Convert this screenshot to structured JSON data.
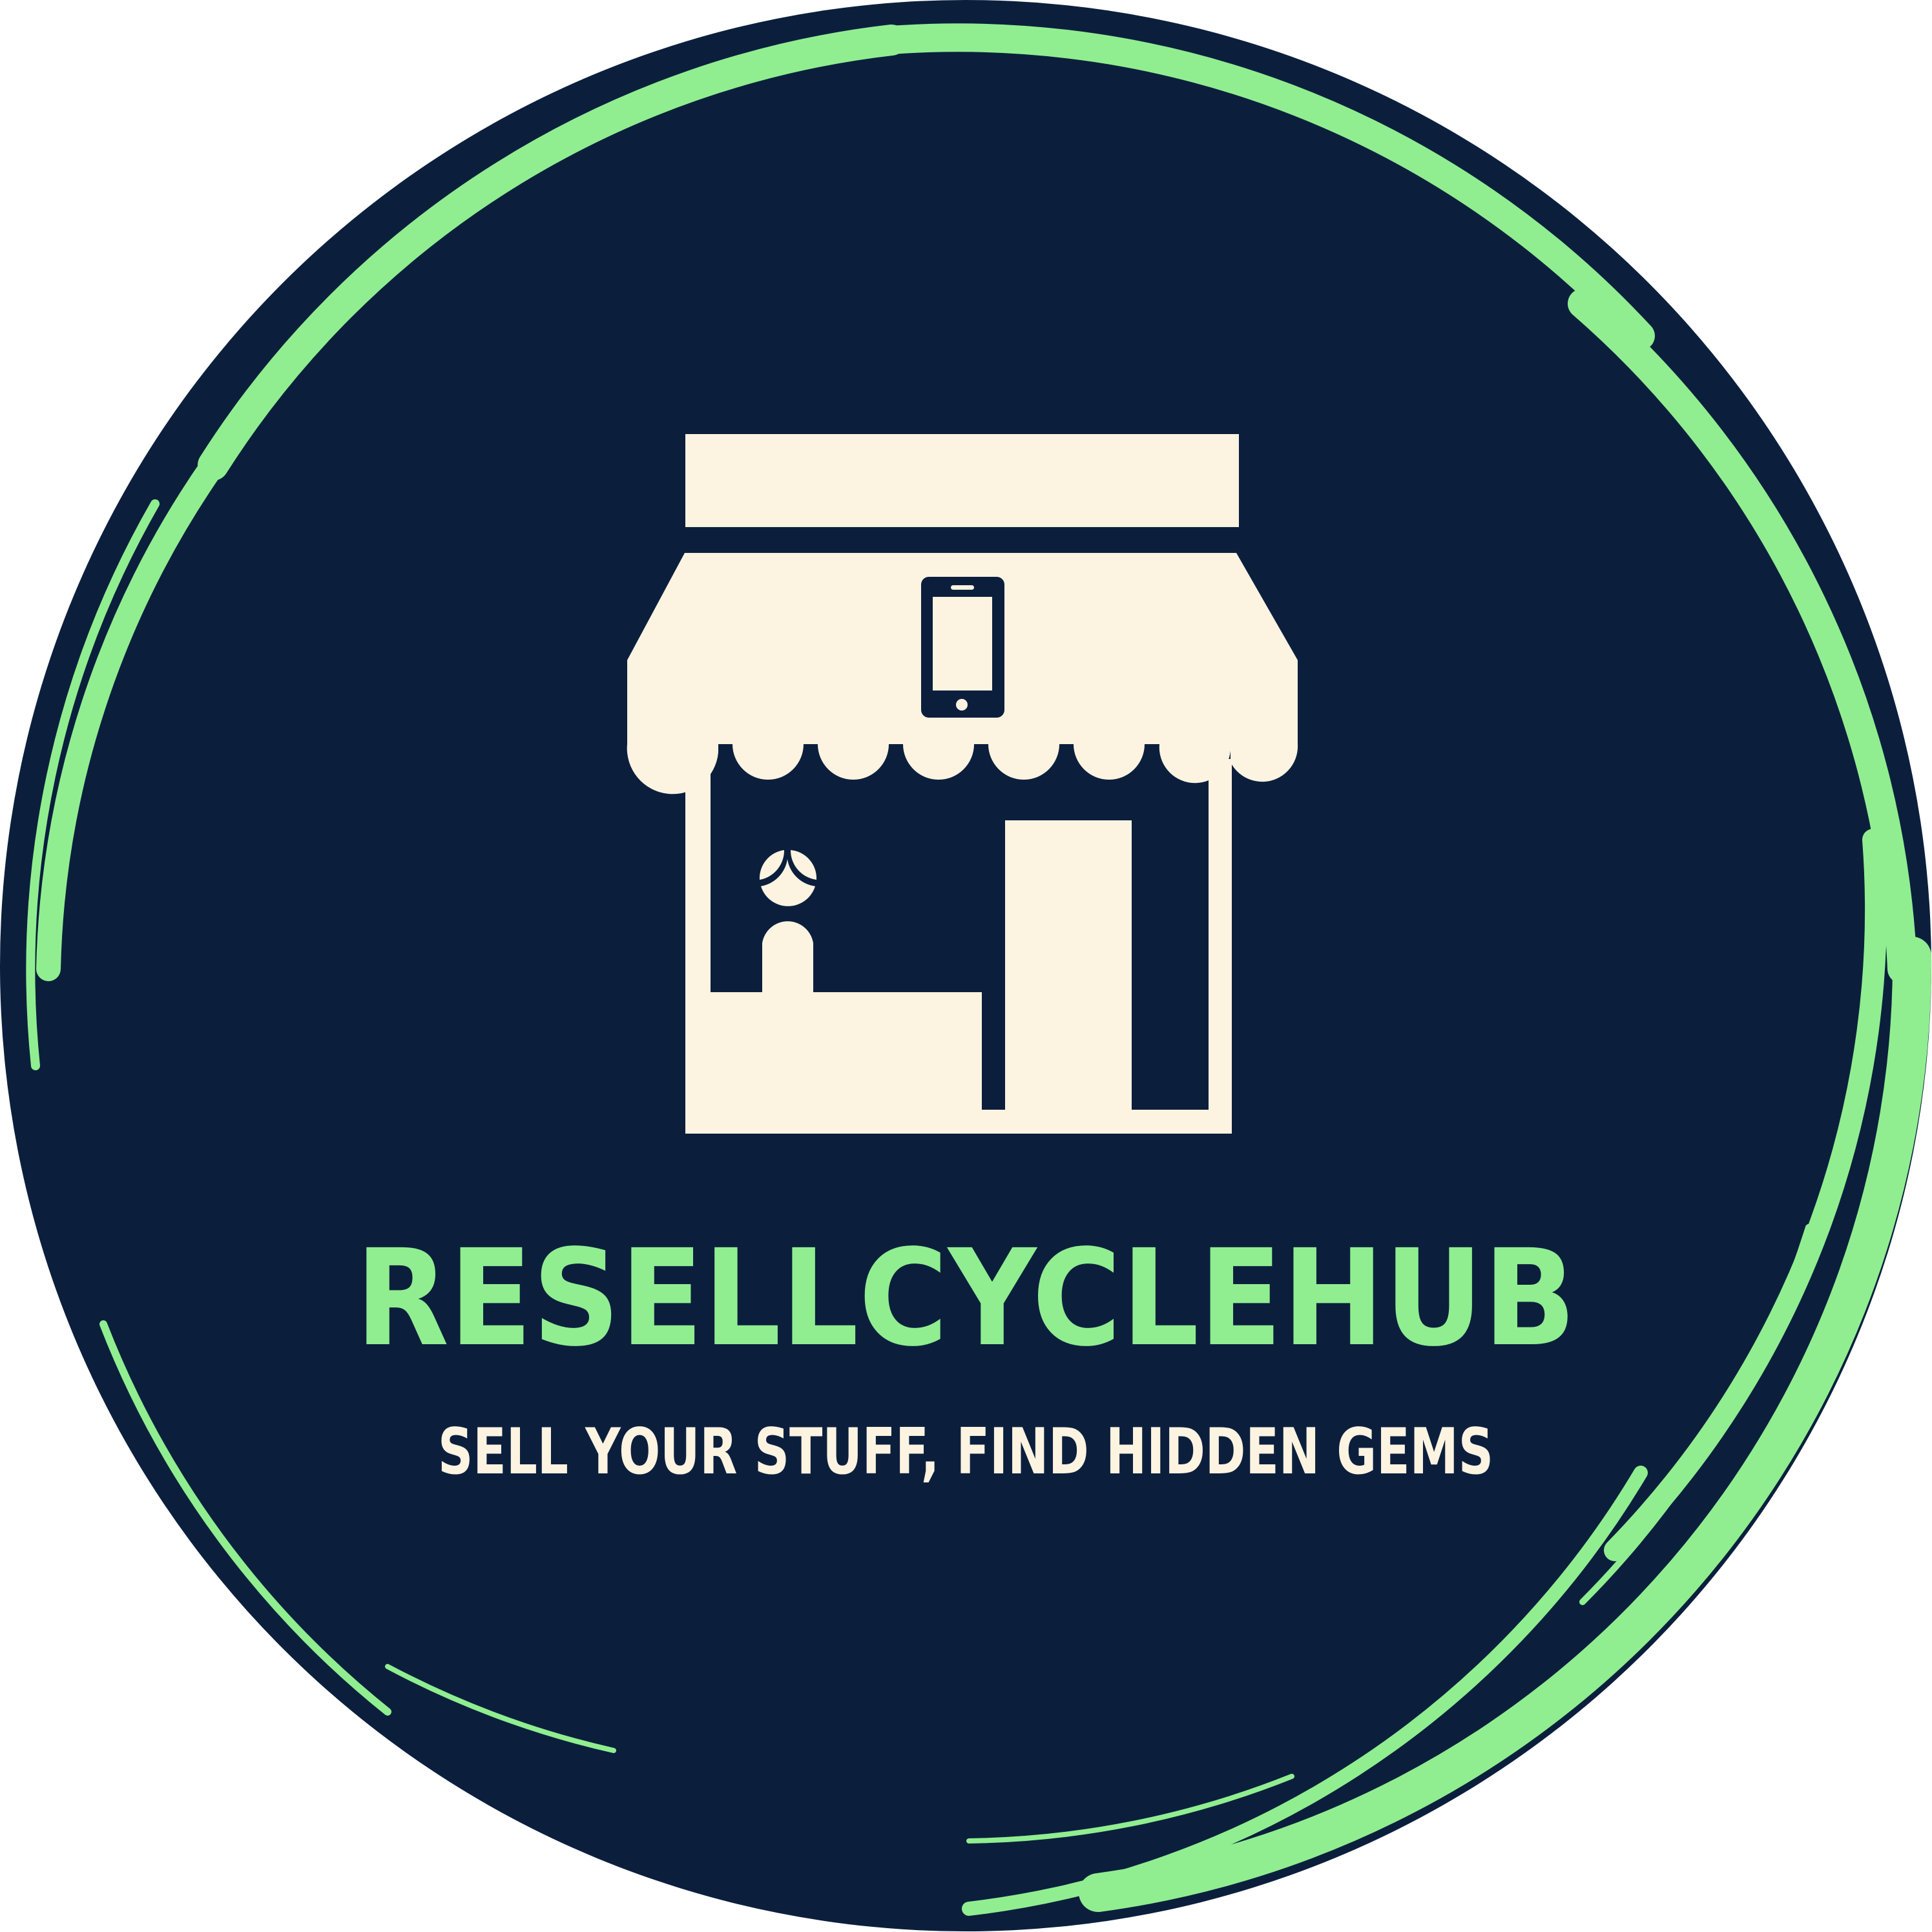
{
  "brand": {
    "name": "RESELLCYCLEHUB",
    "tagline": "SELL YOUR STUFF, FIND HIDDEN GEMS"
  },
  "icons": {
    "storefront": "storefront-icon",
    "phone": "smartphone-icon",
    "shopkeeper": "shopkeeper-icon",
    "door": "door-icon"
  },
  "colors": {
    "background_navy": "#0b1f3d",
    "accent_green": "#90ee90",
    "cream": "#fdf3e1"
  }
}
